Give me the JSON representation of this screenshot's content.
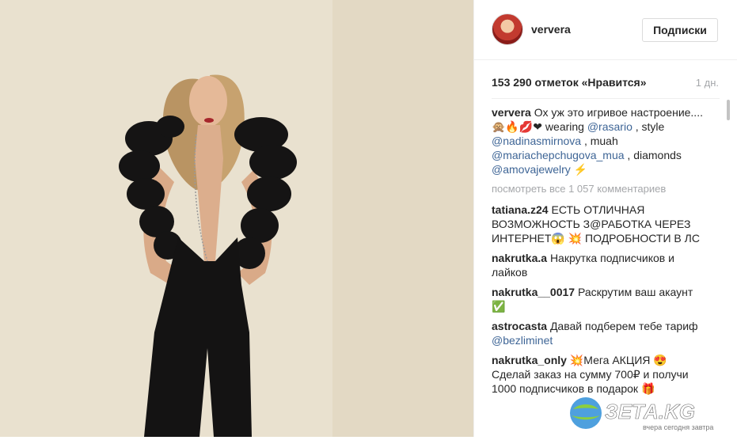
{
  "header": {
    "username": "ververa",
    "follow_label": "Подписки"
  },
  "post": {
    "likes": "153 290 отметок «Нравится»",
    "time": "1 дн."
  },
  "caption": {
    "user": "ververa",
    "text1": "Ох уж это игривое настроение....",
    "emoji1": "🙊🔥💋❤",
    "text2": "wearing",
    "tag1": "@rasario",
    "text3": ", style",
    "tag2": "@nadinasmirnova",
    "text4": ", muah",
    "tag3": "@mariachepchugova_mua",
    "text5": ", diamonds",
    "tag4": "@amovajewelry",
    "emoji2": "⚡"
  },
  "view_all": "посмотреть все 1 057 комментариев",
  "comments": [
    {
      "user": "tatiana.z24",
      "text": "ЕСТЬ ОТЛИЧНАЯ ВОЗМОЖНОСТЬ З@РАБОТКА ЧЕРЕЗ ИНТЕРНЕТ😱 💥 ПОДРОБНОСТИ В ЛС"
    },
    {
      "user": "nakrutka.a",
      "text": "Накрутка подписчиков и лайков"
    },
    {
      "user": "nakrutka__0017",
      "text": "Раскрутим ваш акаунт ✅"
    },
    {
      "user": "astrocasta",
      "text": "Давай подберем тебе тариф",
      "tag": "@bezliminet"
    },
    {
      "user": "nakrutka_only",
      "text": "💥Мега АКЦИЯ 😍 Сделай заказ на сумму 700₽ и получи 1000 подписчиков в подарок 🎁"
    }
  ],
  "watermark": {
    "brand": "ЗЕТА.KG",
    "slogan": "вчера сегодня завтра"
  },
  "colors": {
    "link": "#3e6596",
    "muted": "#a5a7aa",
    "text": "#262626"
  }
}
